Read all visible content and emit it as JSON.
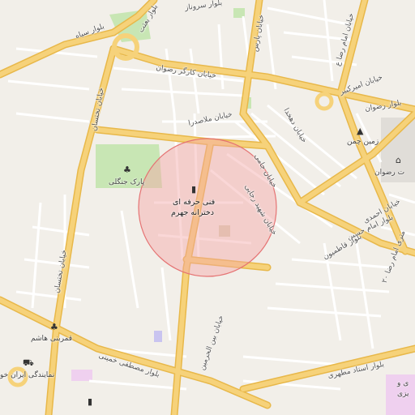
{
  "map": {
    "colors": {
      "background": "#f2efe9",
      "major_road": "#f6d27a",
      "major_road_casing": "#e8b84a",
      "minor_road": "#ffffff",
      "park": "#c8e6b4",
      "radius_fill": "#f4a6a6",
      "radius_stroke": "#e57373"
    },
    "streets": {
      "bolvar_sarvnaz": "بلوار سروناز",
      "bolvar_siah": "بلوار سیاه",
      "bolvar_besat": "بلوار بعثت",
      "khiaban_kargar_rezvan": "خیابان کارگر رضوان",
      "khiaban_pars": "خیابان پارس",
      "khiaban_emam_reza": "خیابان امام رضا ع",
      "khiaban_molasadra": "خیابان ملاصدرا",
      "khiaban_dehkhoda": "خیابان دهخدا",
      "khiaban_jami": "خیابان جامی",
      "khiaban_shahid_rajaei": "خیابان شهید رجایی",
      "bolvar_rezvan": "بلوار رضوان",
      "khiaban_rezvan": "خیابان رضوان",
      "khiaban_takhtsan": "خیابان تختسان",
      "khiaban_takhtsan_2": "خیابان تختسان",
      "khiaban_amir_kabir": "خیابان امیرکبیر",
      "khiaban_ahmadi": "خیابان احمدی",
      "bolvar_emam_hossein": "بلوار امام حسین",
      "bolvar_20_metri": "۲۰ متری امام رضا",
      "bolvar_ghatemion": "بلوار قاطمیون",
      "khiaban_bein_alharamain": "خیابان بین الحرمین",
      "bolvar_mostafa_khomeini": "بلوار مصطفی خمینی",
      "bolvar_ostad_motahari": "بلوار استاد مطهری"
    },
    "pois": {
      "park_jangali": "پارک جنگلی",
      "fanni_herfei_line1": "فنی حرفه ای",
      "fanni_herfei_line2": "دخترانه جهرم",
      "zamin_chaman": "زمین چمن",
      "masjed_rezvan": "ت رضوان",
      "ghamar_bani_hashem": "قمربنی هاشم",
      "namayandegi_iran": "نمایندگی ایران خو",
      "edge_label_line1": "ی و",
      "edge_label_line2": "یزی"
    }
  }
}
